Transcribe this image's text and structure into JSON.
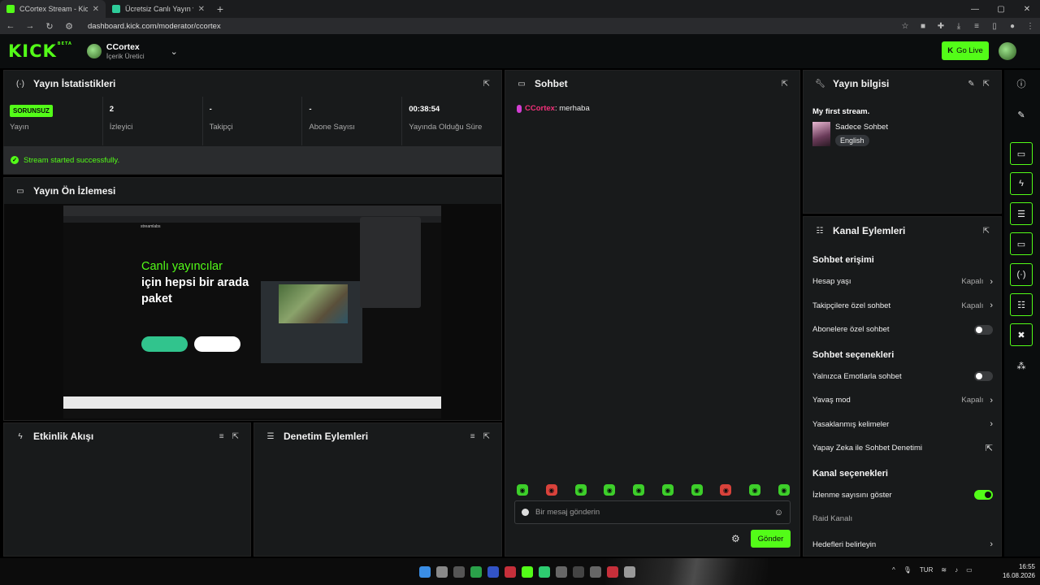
{
  "browser": {
    "tabs": [
      {
        "title": "CCortex Stream - Kick",
        "active": true
      },
      {
        "title": "Ücretsiz Canlı Yayın ve Kayıt Ya",
        "active": false
      }
    ],
    "url": "dashboard.kick.com/moderator/ccortex"
  },
  "header": {
    "logo": "KICK",
    "beta": "BETA",
    "channel_name": "CCortex",
    "channel_role": "İçerik Üretici",
    "go_live_label": "Go Live"
  },
  "stats_panel": {
    "title": "Yayın İstatistikleri",
    "status_badge": "SORUNSUZ",
    "items": [
      {
        "value": "",
        "label": "Yayın"
      },
      {
        "value": "2",
        "label": "İzleyici"
      },
      {
        "value": "-",
        "label": "Takipçi"
      },
      {
        "value": "-",
        "label": "Abone Sayısı"
      },
      {
        "value": "00:38:54",
        "label": "Yayında Olduğu Süre"
      }
    ],
    "success_message": "Stream started successfully."
  },
  "preview_panel": {
    "title": "Yayın Ön İzlemesi",
    "headline_green": "Canlı yayıncılar",
    "headline_rest": "için hepsi bir arada paket",
    "nav_brand": "streamlabs"
  },
  "activity_panel": {
    "title": "Etkinlik Akışı"
  },
  "moderation_panel": {
    "title": "Denetim Eylemleri"
  },
  "chat_panel": {
    "title": "Sohbet",
    "messages": [
      {
        "user": "CCortex",
        "text": ": merhaba"
      }
    ],
    "input_placeholder": "Bir mesaj gönderin",
    "send_label": "Gönder"
  },
  "stream_info_panel": {
    "title": "Yayın bilgisi",
    "stream_title": "My first stream.",
    "category": "Sadece Sohbet",
    "language": "English"
  },
  "channel_actions_panel": {
    "title": "Kanal Eylemleri",
    "chat_access_heading": "Sohbet erişimi",
    "rows_access": [
      {
        "label": "Hesap yaşı",
        "value": "Kapalı"
      },
      {
        "label": "Takipçilere özel sohbet",
        "value": "Kapalı"
      },
      {
        "label": "Abonelere özel sohbet",
        "value": ""
      }
    ],
    "chat_options_heading": "Sohbet seçenekleri",
    "rows_options": [
      {
        "label": "Yalnızca Emotlarla sohbet",
        "value": ""
      },
      {
        "label": "Yavaş mod",
        "value": "Kapalı"
      },
      {
        "label": "Yasaklanmış kelimeler",
        "value": ""
      },
      {
        "label": "Yapay Zeka ile Sohbet Denetimi",
        "value": ""
      }
    ],
    "channel_options_heading": "Kanal seçenekleri",
    "rows_channel": [
      {
        "label": "İzlenme sayısını göster",
        "value": ""
      },
      {
        "label": "Raid Kanalı",
        "value": ""
      },
      {
        "label": "Hedefleri belirleyin",
        "value": ""
      }
    ]
  },
  "taskbar": {
    "language": "TUR",
    "time": "16:55",
    "date": "16.08.2026"
  },
  "colors": {
    "accent": "#53fc18",
    "panel": "#181a1b",
    "background": "#000000"
  }
}
